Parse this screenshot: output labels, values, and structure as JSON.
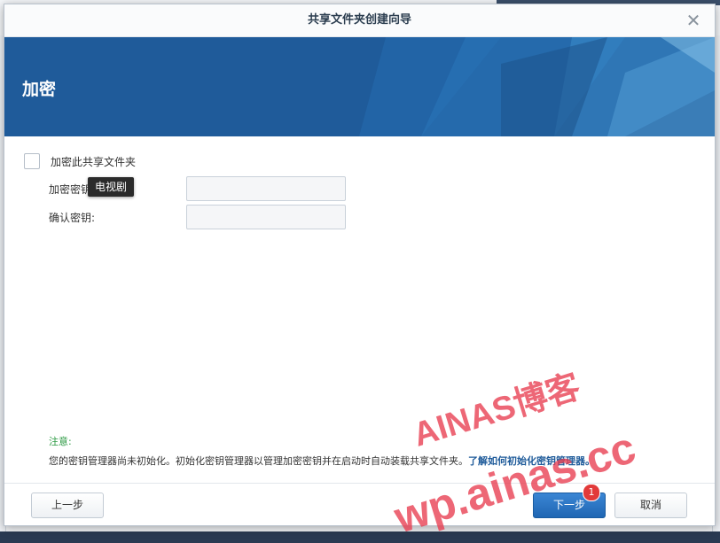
{
  "dialog": {
    "title": "共享文件夹创建向导",
    "close_icon": "close-icon"
  },
  "banner": {
    "title": "加密"
  },
  "form": {
    "encrypt_checkbox_label": "加密此共享文件夹",
    "encrypt_checked": false,
    "key_label": "加密密钥:",
    "confirm_label": "确认密钥:",
    "key_value": "",
    "confirm_value": ""
  },
  "tooltip": {
    "text": "电视剧"
  },
  "note": {
    "title": "注意:",
    "body": "您的密钥管理器尚未初始化。初始化密钥管理器以管理加密密钥并在启动时自动装载共享文件夹。",
    "link": "了解如何初始化密钥管理器。"
  },
  "footer": {
    "prev_label": "上一步",
    "next_label": "下一步",
    "next_badge": "1",
    "cancel_label": "取消"
  },
  "watermark": {
    "line1": "AINAS博客",
    "line2": "wp.ainas.cc"
  },
  "colors": {
    "banner": "#1f5b9a",
    "primary": "#1f66b3",
    "note_title": "#2c9a43",
    "link": "#1f5b9a",
    "watermark": "#e83c50",
    "badge": "#e23a3a"
  }
}
